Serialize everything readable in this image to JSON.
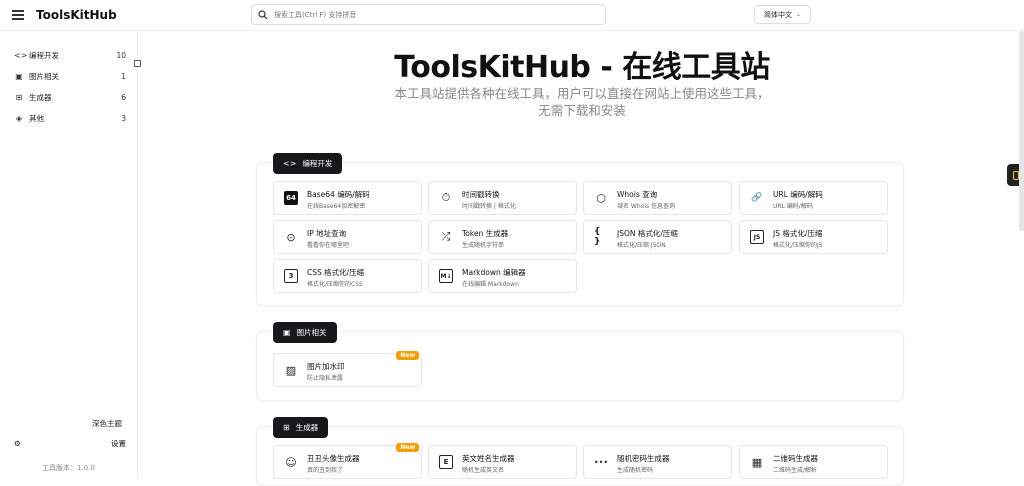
{
  "header": {
    "logo": "ToolsKitHub",
    "search_placeholder": "搜索工具(Ctrl F) 支持拼音",
    "language": "简体中文"
  },
  "sidebar": {
    "items": [
      {
        "icon": "code-icon",
        "label": "编程开发",
        "count": "10"
      },
      {
        "icon": "image-icon",
        "label": "图片相关",
        "count": "1"
      },
      {
        "icon": "generator-icon",
        "label": "生成器",
        "count": "6"
      },
      {
        "icon": "layers-icon",
        "label": "其他",
        "count": "3"
      }
    ],
    "theme_label": "深色主题",
    "settings_label": "设置",
    "version": "工具版本：1.0.0"
  },
  "hero": {
    "title": "ToolsKitHub - 在线工具站",
    "description": "本工具站提供各种在线工具，用户可以直接在网站上使用这些工具，无需下载和安装"
  },
  "sections": [
    {
      "title": "编程开发",
      "icon": "code-icon",
      "tools": [
        {
          "icon": "base64-icon",
          "glyph": "64",
          "title": "Base64 编码/解码",
          "desc": "在线Base64加密解密"
        },
        {
          "icon": "timer-icon",
          "glyph": "⏱",
          "title": "时间戳转换",
          "desc": "时间戳转换 | 格式化"
        },
        {
          "icon": "box-search-icon",
          "glyph": "⬡",
          "title": "Whois 查询",
          "desc": "域名 Whois 信息查询"
        },
        {
          "icon": "link-icon",
          "glyph": "🔗",
          "title": "URL 编码/解码",
          "desc": "URL 编码/解码"
        },
        {
          "icon": "location-icon",
          "glyph": "⊙",
          "title": "IP 地址查询",
          "desc": "看看你在哪里吧"
        },
        {
          "icon": "shuffle-icon",
          "glyph": "⤮",
          "title": "Token 生成器",
          "desc": "生成随机字符串"
        },
        {
          "icon": "braces-icon",
          "glyph": "{ }",
          "title": "JSON 格式化/压缩",
          "desc": "格式化/压缩 JSON"
        },
        {
          "icon": "js-icon",
          "glyph": "JS",
          "title": "JS 格式化/压缩",
          "desc": "格式化/压缩你的JS"
        },
        {
          "icon": "css-icon",
          "glyph": "3",
          "title": "CSS 格式化/压缩",
          "desc": "格式化/压缩你的CSS"
        },
        {
          "icon": "markdown-icon",
          "glyph": "M↓",
          "title": "Markdown 编辑器",
          "desc": "在线编辑 Markdown"
        }
      ]
    },
    {
      "title": "图片相关",
      "icon": "image-icon",
      "tools": [
        {
          "icon": "watermark-icon",
          "glyph": "▨",
          "title": "图片加水印",
          "desc": "防止隐私泄露",
          "badge": "New"
        }
      ]
    },
    {
      "title": "生成器",
      "icon": "generator-icon",
      "tools": [
        {
          "icon": "face-scan-icon",
          "glyph": "☺",
          "title": "丑丑头像生成器",
          "desc": "真的丑到我了",
          "badge": "New"
        },
        {
          "icon": "name-icon",
          "glyph": "E",
          "title": "英文姓名生成器",
          "desc": "随机生成英文名"
        },
        {
          "icon": "password-icon",
          "glyph": "•••",
          "title": "随机密码生成器",
          "desc": "生成随机密码"
        },
        {
          "icon": "qrcode-icon",
          "glyph": "▦",
          "title": "二维码生成器",
          "desc": "二维码生成/解析"
        }
      ]
    }
  ]
}
